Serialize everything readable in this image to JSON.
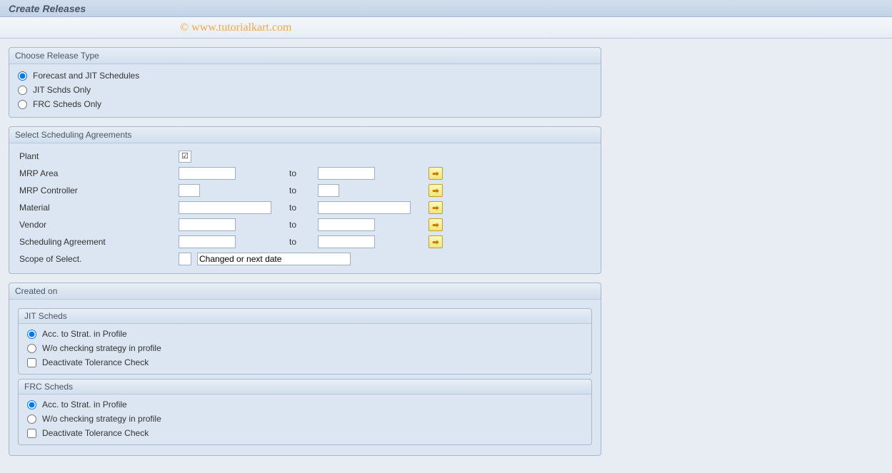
{
  "header": {
    "title": "Create Releases",
    "watermark": "© www.tutorialkart.com"
  },
  "releaseType": {
    "title": "Choose Release Type",
    "option1": "Forecast and JIT Schedules",
    "option2": "JIT Schds Only",
    "option3": "FRC Scheds Only"
  },
  "schedulingAgreements": {
    "title": "Select Scheduling Agreements",
    "plant_label": "Plant",
    "plant_value": "☑",
    "mrp_area_label": "MRP Area",
    "mrp_controller_label": "MRP Controller",
    "material_label": "Material",
    "vendor_label": "Vendor",
    "scheduling_agreement_label": "Scheduling Agreement",
    "scope_label": "Scope of Select.",
    "scope_text": "Changed or next date",
    "to_label": "to"
  },
  "createdOn": {
    "title": "Created on",
    "jit": {
      "title": "JIT Scheds",
      "option1": "Acc. to Strat. in Profile",
      "option2": "W/o checking strategy in profile",
      "checkbox1": "Deactivate Tolerance Check"
    },
    "frc": {
      "title": "FRC Scheds",
      "option1": "Acc. to Strat. in Profile",
      "option2": "W/o checking strategy in profile",
      "checkbox1": "Deactivate Tolerance Check"
    }
  }
}
